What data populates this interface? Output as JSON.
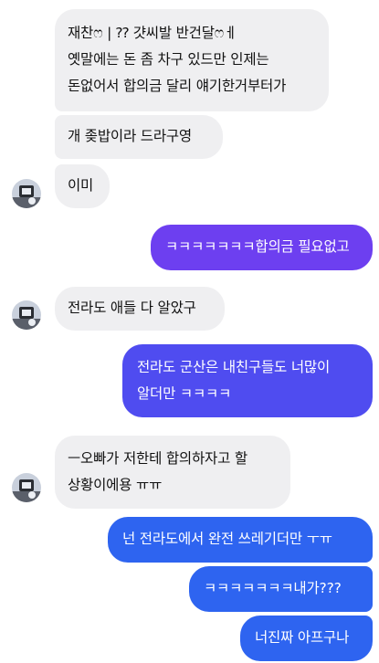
{
  "messages": [
    {
      "direction": "incoming",
      "text": "재찬ෆ | ⁇ 걋씨발 반건달ෆㅔ\n옛말에는 돈 좀 차구 있드만 인제는\n돈없어서 합의금 달리 얘기한거부터가"
    },
    {
      "direction": "incoming",
      "text": "개 좆밥이라 드라구영"
    },
    {
      "direction": "incoming",
      "text": "이미"
    },
    {
      "direction": "outgoing",
      "text": "ㅋㅋㅋㅋㅋㅋㅋ합의금 필요없고"
    },
    {
      "direction": "incoming",
      "text": "전라도 애들 다 알았구"
    },
    {
      "direction": "outgoing",
      "text": "전라도 군산은 내친구들도 너많이\n알더만 ㅋㅋㅋㅋ"
    },
    {
      "direction": "incoming",
      "text": "ㅡ오빠가 저한테 합의하자고 할\n상황이에용 ㅠㅠ"
    },
    {
      "direction": "outgoing",
      "text": "넌 전라도에서 완전 쓰레기더만 ㅜㅠ"
    },
    {
      "direction": "outgoing",
      "text": "ㅋㅋㅋㅋㅋㅋㅋ내가???"
    },
    {
      "direction": "outgoing",
      "text": "너진짜 아프구나"
    }
  ],
  "colors": {
    "incoming_bubble": "#efeff1",
    "outgoing_purple": "#6d3ff0",
    "outgoing_blue": "#2e64f0"
  },
  "icons": {
    "avatar": "contact-avatar"
  }
}
